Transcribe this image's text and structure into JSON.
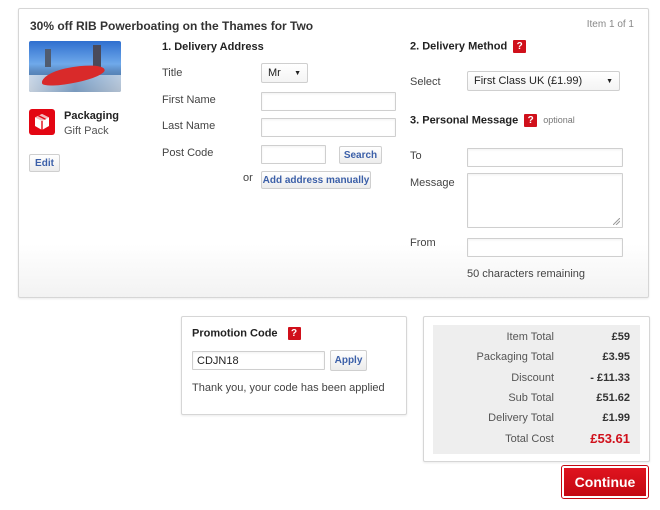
{
  "product": {
    "title": "30% off RIB Powerboating on the Thames for Two",
    "item_counter": "Item 1 of 1",
    "packaging_name": "Packaging",
    "packaging_sub": "Gift Pack",
    "edit_label": "Edit"
  },
  "delivery_address": {
    "heading": "1. Delivery Address",
    "title_label": "Title",
    "title_value": "Mr",
    "first_name_label": "First Name",
    "last_name_label": "Last Name",
    "post_code_label": "Post Code",
    "search_label": "Search",
    "or_label": "or",
    "add_manually_label": "Add address manually"
  },
  "delivery_method": {
    "heading": "2. Delivery Method",
    "help": "?",
    "select_label": "Select",
    "selected_value": "First Class UK (£1.99)"
  },
  "personal_message": {
    "heading": "3. Personal Message",
    "help": "?",
    "optional_label": "optional",
    "to_label": "To",
    "message_label": "Message",
    "from_label": "From",
    "chars_remaining": "50 characters remaining"
  },
  "promotion": {
    "heading": "Promotion Code",
    "help": "?",
    "code_value": "CDJN18",
    "apply_label": "Apply",
    "status_message": "Thank you, your code has been applied"
  },
  "totals": {
    "rows": [
      {
        "label": "Item Total",
        "value": "£59"
      },
      {
        "label": "Packaging Total",
        "value": "£3.95"
      },
      {
        "label": "Discount",
        "value": "- £11.33"
      },
      {
        "label": "Sub Total",
        "value": "£51.62"
      },
      {
        "label": "Delivery Total",
        "value": "£1.99"
      }
    ],
    "total_label": "Total Cost",
    "total_value": "£53.61"
  },
  "continue_label": "Continue",
  "colors": {
    "accent_red": "#d0101b",
    "link_blue": "#3b5fa8"
  }
}
